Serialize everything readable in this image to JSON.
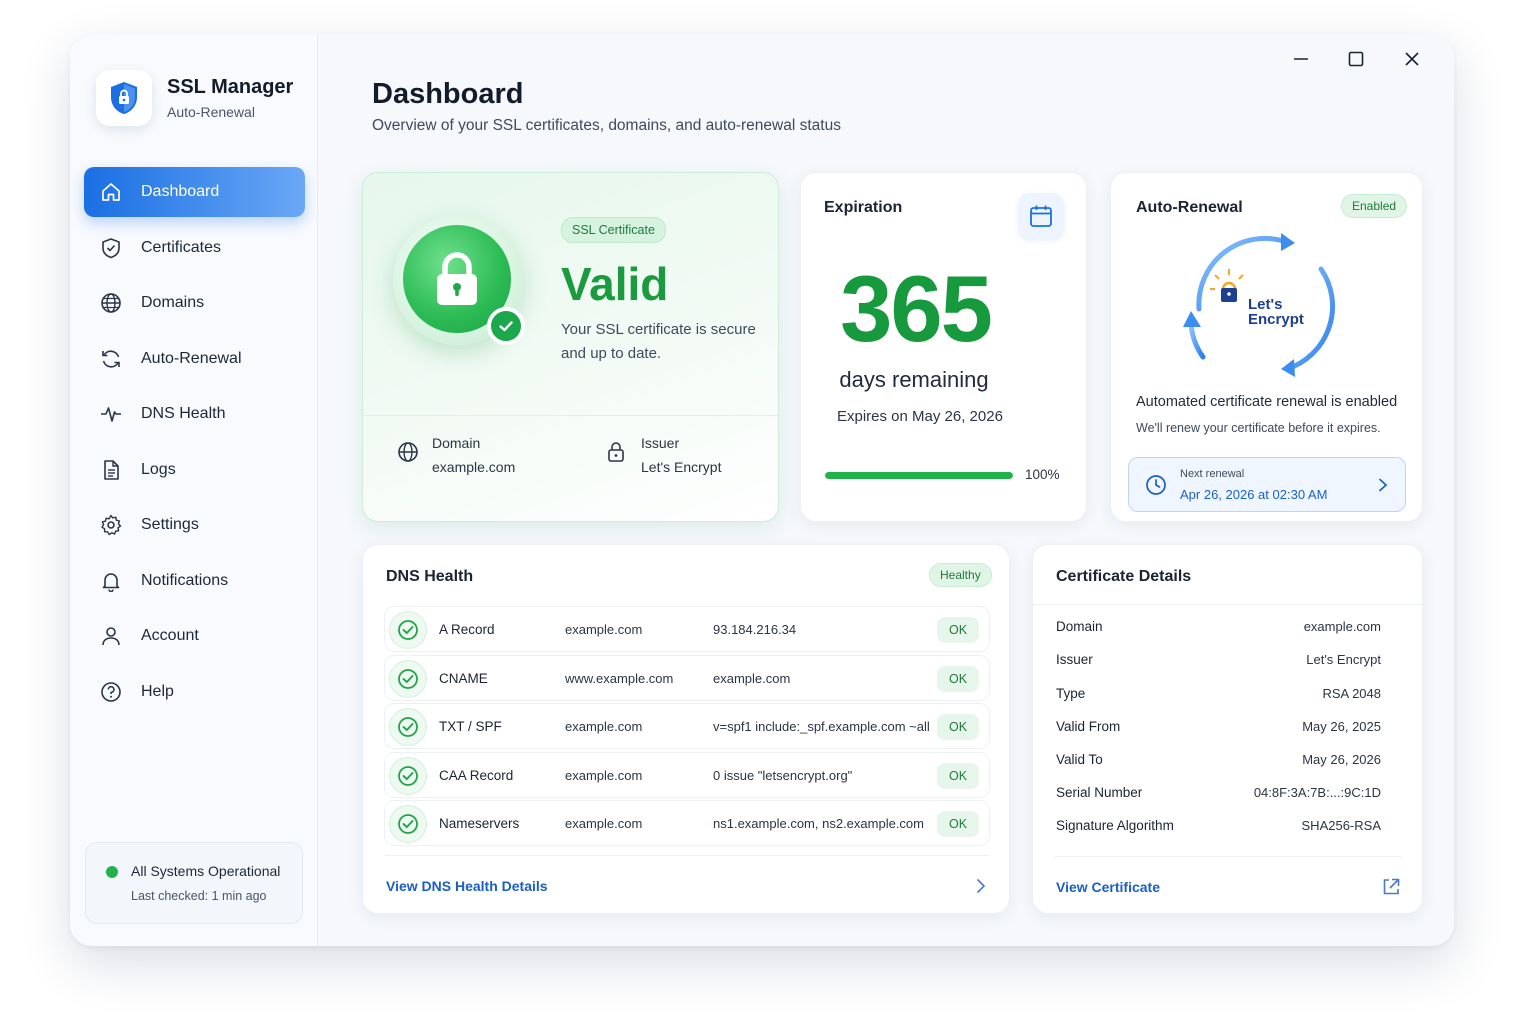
{
  "app": {
    "title": "SSL Manager",
    "subtitle": "Auto-Renewal"
  },
  "sidebar": {
    "items": [
      {
        "label": "Dashboard",
        "icon": "home-icon",
        "active": true
      },
      {
        "label": "Certificates",
        "icon": "shield-check-icon"
      },
      {
        "label": "Domains",
        "icon": "globe-icon"
      },
      {
        "label": "Auto-Renewal",
        "icon": "refresh-icon"
      },
      {
        "label": "DNS Health",
        "icon": "pulse-icon"
      },
      {
        "label": "Logs",
        "icon": "document-icon"
      },
      {
        "label": "Settings",
        "icon": "gear-icon"
      },
      {
        "label": "Notifications",
        "icon": "bell-icon"
      },
      {
        "label": "Account",
        "icon": "user-icon"
      },
      {
        "label": "Help",
        "icon": "help-icon"
      }
    ],
    "status": {
      "title": "All Systems Operational",
      "subtitle": "Last checked: 1 min ago",
      "color": "#22b24c"
    }
  },
  "header": {
    "title": "Dashboard",
    "subtitle": "Overview of your SSL certificates, domains, and auto-renewal status"
  },
  "ssl": {
    "badge": "SSL Certificate",
    "status": "Valid",
    "description": "Your SSL certificate is secure and up to date.",
    "domain_label": "Domain",
    "domain": "example.com",
    "issuer_label": "Issuer",
    "issuer": "Let's Encrypt"
  },
  "expiration": {
    "title": "Expiration",
    "days": "365",
    "days_label": "days remaining",
    "expires_on": "Expires on May 26, 2026",
    "progress": 1.0,
    "progress_label": "100%"
  },
  "auto_renewal": {
    "title": "Auto-Renewal",
    "badge": "Enabled",
    "logo_line1": "Let's",
    "logo_line2": "Encrypt",
    "description": "Automated certificate renewal is enabled",
    "note": "We'll renew your certificate before it expires.",
    "next_label": "Next renewal",
    "next_value": "Apr 26, 2026 at 02:30 AM"
  },
  "dns": {
    "title": "DNS Health",
    "badge": "Healthy",
    "rows": [
      {
        "type": "A Record",
        "host": "example.com",
        "value": "93.184.216.34",
        "status": "OK"
      },
      {
        "type": "CNAME",
        "host": "www.example.com",
        "value": "example.com",
        "status": "OK"
      },
      {
        "type": "TXT / SPF",
        "host": "example.com",
        "value": "v=spf1 include:_spf.example.com ~all",
        "status": "OK"
      },
      {
        "type": "CAA Record",
        "host": "example.com",
        "value": "0 issue \"letsencrypt.org\"",
        "status": "OK"
      },
      {
        "type": "Nameservers",
        "host": "example.com",
        "value": "ns1.example.com, ns2.example.com",
        "status": "OK"
      }
    ],
    "link": "View DNS Health Details"
  },
  "cert_details": {
    "title": "Certificate Details",
    "rows": [
      {
        "label": "Domain",
        "value": "example.com"
      },
      {
        "label": "Issuer",
        "value": "Let's Encrypt"
      },
      {
        "label": "Type",
        "value": "RSA 2048"
      },
      {
        "label": "Valid From",
        "value": "May 26, 2025"
      },
      {
        "label": "Valid To",
        "value": "May 26, 2026"
      },
      {
        "label": "Serial Number",
        "value": "04:8F:3A:7B:...:9C:1D"
      },
      {
        "label": "Signature Algorithm",
        "value": "SHA256-RSA"
      }
    ],
    "link": "View Certificate"
  },
  "colors": {
    "accent": "#1a6fe3",
    "success": "#1b9a3f",
    "link": "#1a5fc8"
  }
}
